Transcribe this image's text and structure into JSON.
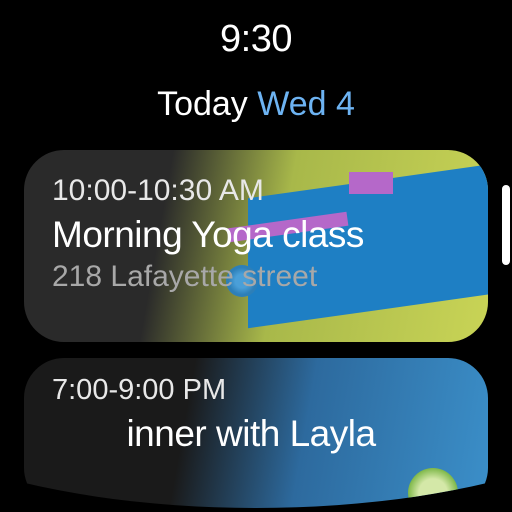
{
  "clock": "9:30",
  "header": {
    "label": "Today",
    "date": "Wed 4"
  },
  "events": [
    {
      "time": "10:00-10:30 AM",
      "title": "Morning Yoga class",
      "location": "218 Lafayette street"
    },
    {
      "time": "7:00-9:00 PM",
      "title": "inner with Layla"
    }
  ]
}
